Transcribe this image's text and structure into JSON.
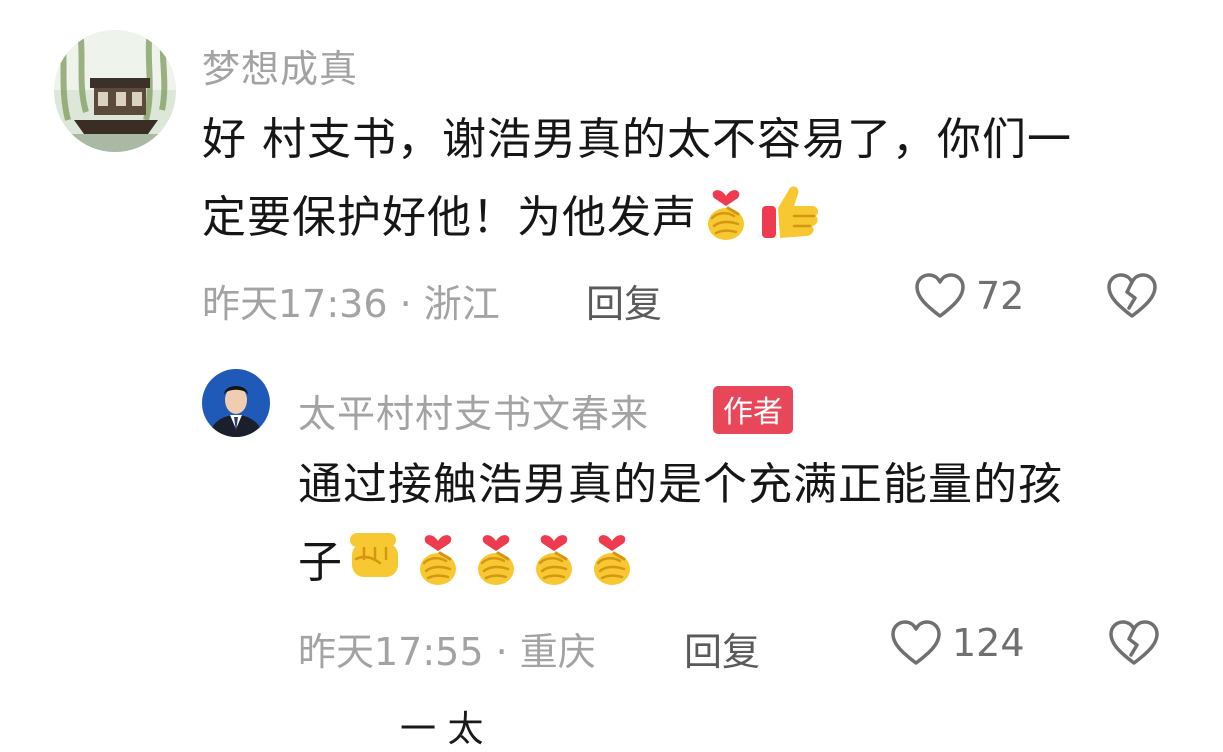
{
  "comment": {
    "username": "梦想成真",
    "line1": "好 村支书，谢浩男真的太不容易了，你们一",
    "line2": "定要保护好他！为他发声",
    "time": "昨天17:36",
    "location": "浙江",
    "reply_label": "回复",
    "likes": "72",
    "emojis": [
      "finger-heart-emoji",
      "thumbs-up-emoji"
    ]
  },
  "reply": {
    "username": "太平村村支书文春来",
    "badge": "作者",
    "line1": "通过接触浩男真的是个充满正能量的孩",
    "line2": "子",
    "time": "昨天17:55",
    "location": "重庆",
    "reply_label": "回复",
    "likes": "124",
    "emojis": [
      "fist-emoji",
      "finger-heart-emoji",
      "finger-heart-emoji",
      "finger-heart-emoji",
      "finger-heart-emoji"
    ]
  },
  "separator": " · ",
  "partial_text": "一  太"
}
